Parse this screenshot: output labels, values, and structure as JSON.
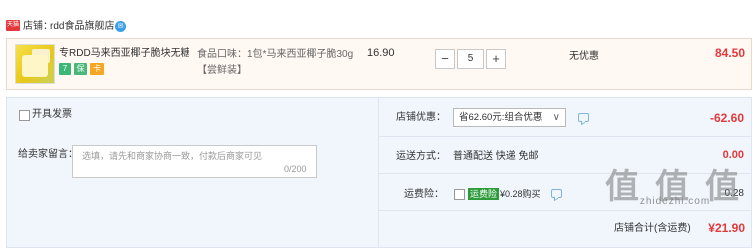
{
  "shop": {
    "badge": "天猫",
    "label": "店铺：",
    "name": "rdd食品旗舰店",
    "contact_icon": "chat-bubble-icon"
  },
  "item": {
    "title": "专RDD马来西亚椰子脆块无糖...",
    "badges": [
      "7",
      "保",
      "卡"
    ],
    "spec": "食品口味：1包*马来西亚椰子脆30g【尝鲜装】",
    "unit_price": "16.90",
    "quantity": "5",
    "qty_minus": "−",
    "qty_plus": "+",
    "promotion": "无优惠",
    "line_total": "84.50"
  },
  "options": {
    "anonymous_purchase": "开具发票",
    "message_label": "给卖家留言：",
    "message_placeholder": "选填，请先和商家协商一致，付款后商家可见",
    "message_counter": "0/200"
  },
  "summary": {
    "shop_discount_label": "店铺优惠：",
    "shop_discount_value": "省62.60元:组合优惠",
    "shop_discount_amount": "-62.60",
    "delivery_label": "运送方式：",
    "delivery_method": "普通配送 快递 免邮",
    "delivery_fee": "0.00",
    "insurance_label": "运费险：",
    "insurance_tag": "运费险",
    "insurance_text": "¥0.28购买",
    "insurance_amount": "0.28",
    "total_label": "店铺合计(含运费)",
    "total_amount": "¥21.90"
  },
  "watermark": {
    "glyphs": [
      "值",
      "值",
      "值"
    ],
    "url": "zhidezhi.com"
  },
  "colors": {
    "price_red": "#e4393c",
    "panel_bg": "#f0f6fc",
    "item_bg": "#fff8f3",
    "insurance_green": "#2e9b3a"
  }
}
